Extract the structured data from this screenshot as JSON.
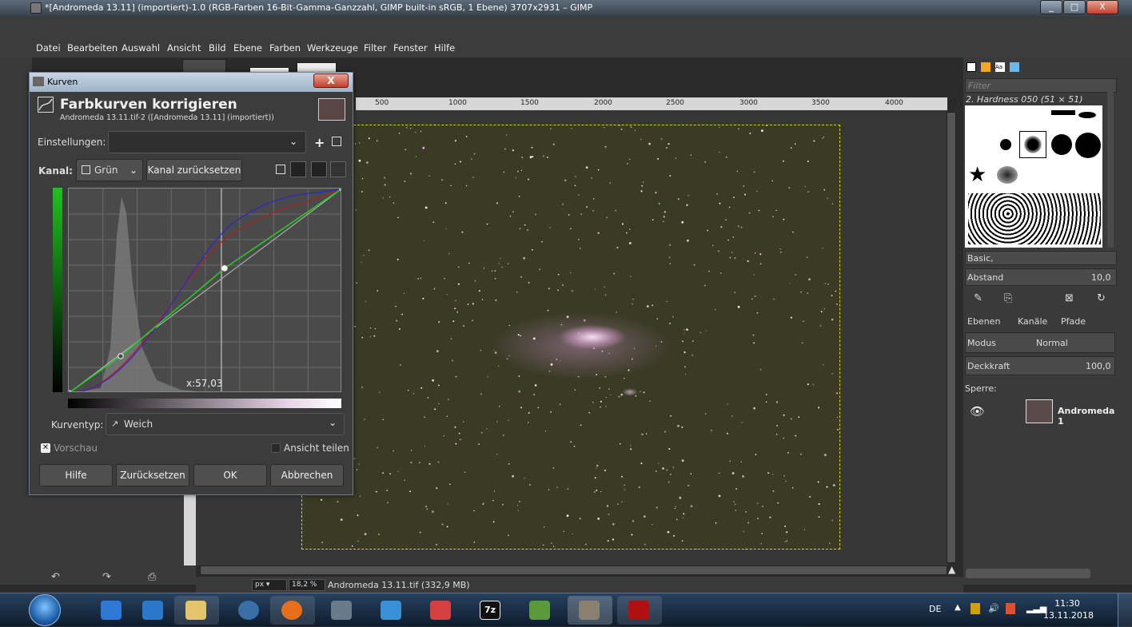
{
  "window": {
    "title": "*[Andromeda 13.11] (importiert)-1.0 (RGB-Farben 16-Bit-Gamma-Ganzzahl, GIMP built-in sRGB, 1 Ebene) 3707x2931 – GIMP",
    "controls": [
      "_",
      "□",
      "X"
    ]
  },
  "menubar": [
    "Datei",
    "Bearbeiten",
    "Auswahl",
    "Ansicht",
    "Bild",
    "Ebene",
    "Farben",
    "Werkzeuge",
    "Filter",
    "Fenster",
    "Hilfe"
  ],
  "ruler": {
    "ticks": [
      "500",
      "1000",
      "1500",
      "2000",
      "2500",
      "3000",
      "3500",
      "4000"
    ]
  },
  "statusbar": {
    "unit": "px",
    "zoom": "18,2 %",
    "info": "Andromeda 13.11.tif (332,9 MB)"
  },
  "curves": {
    "window_title": "Kurven",
    "close": "X",
    "heading": "Farbkurven korrigieren",
    "subheading": "Andromeda 13.11.tif-2 ([Andromeda 13.11] (importiert))",
    "presets_label": "Einstellungen:",
    "preset_value": "",
    "channel_label": "Kanal:",
    "channel_value": "Grün",
    "reset_channel": "Kanal zurücksetzen",
    "readout": "x:57,03",
    "curve_type_label": "Kurventyp:",
    "curve_type_value": "Weich",
    "preview_label": "Vorschau",
    "split_view_label": "Ansicht teilen",
    "buttons": {
      "help": "Hilfe",
      "reset": "Zurücksetzen",
      "ok": "OK",
      "cancel": "Abbrechen"
    },
    "curve_points": [
      [
        0,
        0
      ],
      [
        19,
        18
      ],
      [
        57,
        61
      ],
      [
        100,
        100
      ]
    ],
    "colors": {
      "green": "#28c828",
      "red": "#b02020",
      "blue": "#2828c8",
      "gray": "#bbbbbb"
    }
  },
  "right_dock": {
    "filter_placeholder": "Filter",
    "brush_name": "2. Hardness 050 (51 × 51)",
    "brush_tag": "Basic,",
    "spacing_label": "Abstand",
    "spacing_value": "10,0",
    "tabs": [
      "Ebenen",
      "Kanäle",
      "Pfade"
    ],
    "mode_label": "Modus",
    "mode_value": "Normal",
    "opacity_label": "Deckkraft",
    "opacity_value": "100,0",
    "lock_label": "Sperre:",
    "layer_name": "Andromeda 1"
  },
  "taskbar": {
    "lang": "DE",
    "time": "11:30",
    "date": "13.11.2018",
    "apps": [
      "ie-icon",
      "media-icon",
      "explorer-icon",
      "thunderbird-icon",
      "firefox-icon",
      "photo-icon",
      "control-panel-icon",
      "paint-icon",
      "7zip-icon",
      "flow-icon",
      "gimp-icon",
      "pdf-icon"
    ]
  }
}
